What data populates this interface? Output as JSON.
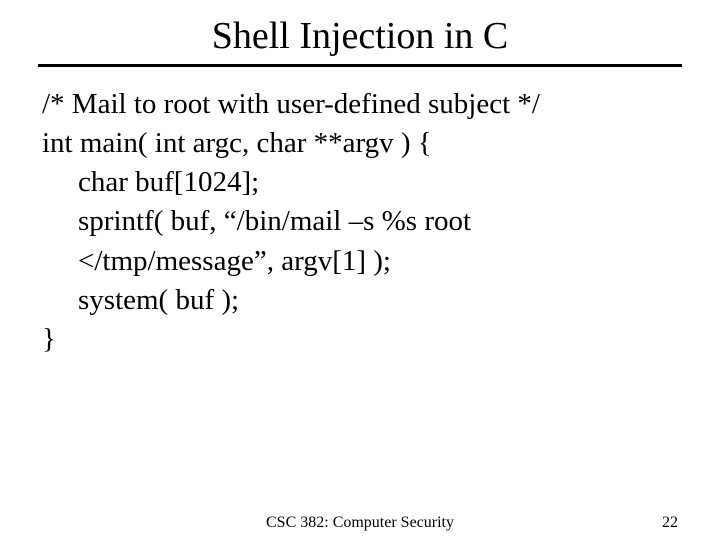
{
  "title": "Shell Injection in C",
  "code": {
    "comment": "/* Mail to root with user-defined subject */",
    "line1": "int main( int argc, char **argv ) {",
    "line2": "char buf[1024];",
    "line3a": "sprintf( buf, “/bin/mail –s %s root",
    "line3b": "</tmp/message”, argv[1] );",
    "line4": "system( buf );",
    "line5": "}"
  },
  "footer": {
    "course": "CSC 382: Computer Security",
    "page": "22"
  }
}
